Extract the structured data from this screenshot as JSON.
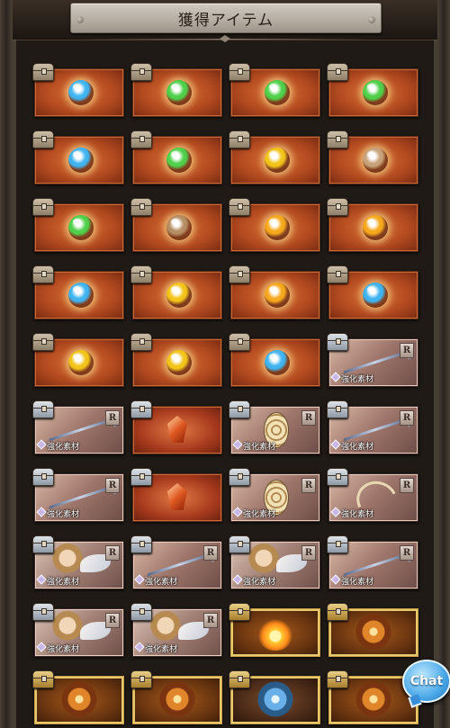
{
  "header": {
    "title": "獲得アイテム"
  },
  "chat": {
    "label": "Chat"
  },
  "rarity_label": "R",
  "material_label": "強化素材",
  "items": [
    {
      "type": "treasure",
      "orb": "#3fb4f0"
    },
    {
      "type": "treasure",
      "orb": "#4fd04a"
    },
    {
      "type": "treasure",
      "orb": "#4fd04a"
    },
    {
      "type": "treasure",
      "orb": "#4fd04a"
    },
    {
      "type": "treasure",
      "orb": "#3fb4f0"
    },
    {
      "type": "treasure",
      "orb": "#4fd04a"
    },
    {
      "type": "treasure",
      "orb": "#f2c41a"
    },
    {
      "type": "treasure",
      "orb": "#c7a27a"
    },
    {
      "type": "treasure",
      "orb": "#4fd04a"
    },
    {
      "type": "treasure",
      "orb": "#b58e63"
    },
    {
      "type": "treasure",
      "orb": "#f5a81c"
    },
    {
      "type": "treasure",
      "orb": "#f5a81c"
    },
    {
      "type": "treasure",
      "orb": "#3fb4f0"
    },
    {
      "type": "treasure",
      "orb": "#f2c41a"
    },
    {
      "type": "treasure",
      "orb": "#f5a81c"
    },
    {
      "type": "treasure",
      "orb": "#3fb4f0"
    },
    {
      "type": "treasure",
      "orb": "#f2c41a"
    },
    {
      "type": "treasure",
      "orb": "#f2c41a"
    },
    {
      "type": "treasure",
      "orb": "#3fb4f0"
    },
    {
      "type": "weapon",
      "art": "spear"
    },
    {
      "type": "weapon",
      "art": "spear"
    },
    {
      "type": "frag",
      "art": "fragment"
    },
    {
      "type": "weapon",
      "art": "egg"
    },
    {
      "type": "weapon",
      "art": "spear"
    },
    {
      "type": "weapon",
      "art": "spear"
    },
    {
      "type": "frag",
      "art": "fragment"
    },
    {
      "type": "weapon",
      "art": "egg"
    },
    {
      "type": "weapon",
      "art": "bow"
    },
    {
      "type": "chara",
      "art": "chara"
    },
    {
      "type": "weapon",
      "art": "spear"
    },
    {
      "type": "chara",
      "art": "chara"
    },
    {
      "type": "weapon",
      "art": "spear"
    },
    {
      "type": "chara",
      "art": "chara"
    },
    {
      "type": "chara",
      "art": "chara"
    },
    {
      "type": "sr",
      "art": "flame"
    },
    {
      "type": "sr",
      "art": "emblem"
    },
    {
      "type": "sr",
      "art": "emblem"
    },
    {
      "type": "sr",
      "art": "emblem"
    },
    {
      "type": "sr-blue",
      "art": "emblem-blue"
    },
    {
      "type": "sr",
      "art": "emblem"
    }
  ]
}
